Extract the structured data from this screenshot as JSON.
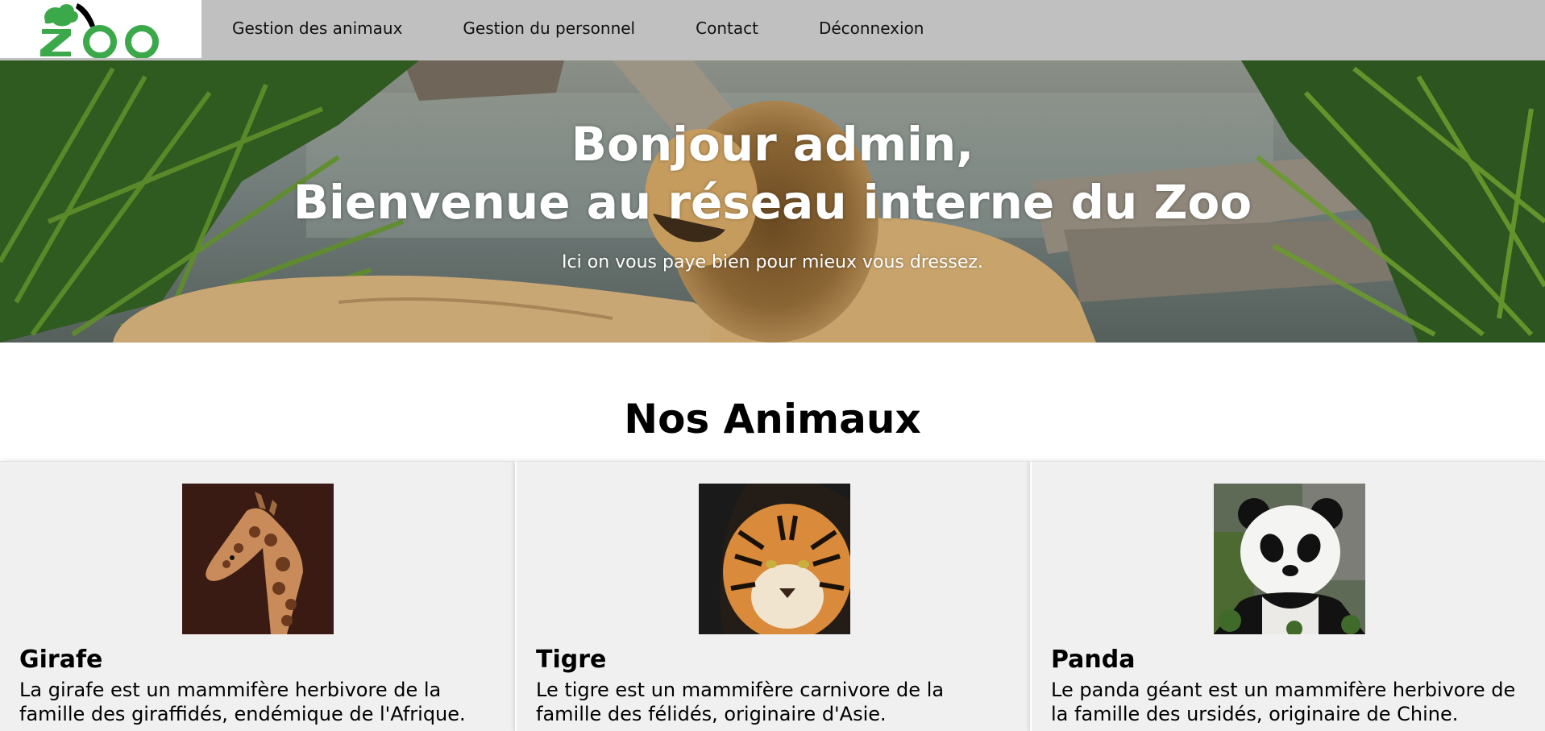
{
  "nav": {
    "logo_alt": "Zoo",
    "links": [
      {
        "label": "Gestion des animaux"
      },
      {
        "label": "Gestion du personnel"
      },
      {
        "label": "Contact"
      },
      {
        "label": "Déconnexion"
      }
    ],
    "colors": {
      "bar": "#c0c0c0",
      "logo_green": "#3ba84a"
    }
  },
  "hero": {
    "title_line1": "Bonjour admin,",
    "title_line2": "Bienvenue au réseau interne du Zoo",
    "subtitle": "Ici on vous paye bien pour mieux vous dressez.",
    "image": "lion-resting-by-water-photo"
  },
  "section": {
    "title": "Nos Animaux"
  },
  "animals": [
    {
      "name": "Girafe",
      "description_line1": "La girafe est un mammifère herbivore de la",
      "description_line2": "famille des giraffidés, endémique de l'Afrique.",
      "image": "giraffe-portrait-photo"
    },
    {
      "name": "Tigre",
      "description_line1": "Le tigre est un mammifère carnivore de la",
      "description_line2": "famille des félidés, originaire d'Asie.",
      "image": "tiger-portrait-photo"
    },
    {
      "name": "Panda",
      "description_line1": "Le panda géant est un mammifère herbivore de",
      "description_line2": "la famille des ursidés, originaire de Chine.",
      "image": "panda-portrait-photo"
    }
  ]
}
